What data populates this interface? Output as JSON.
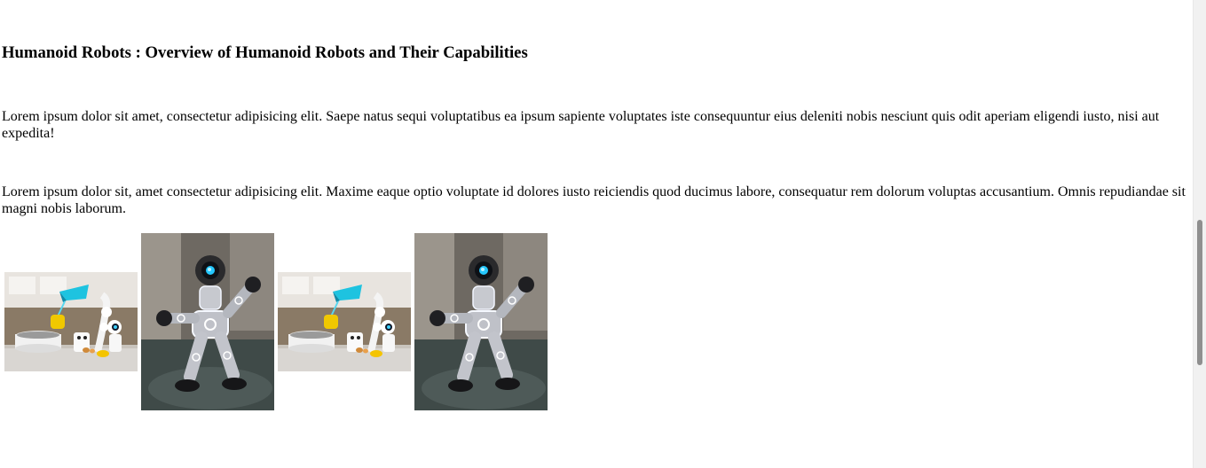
{
  "heading": "Humanoid Robots : Overview of Humanoid Robots and Their Capabilities",
  "paragraphs": [
    "Lorem ipsum dolor sit amet, consectetur adipisicing elit. Saepe natus sequi voluptatibus ea ipsum sapiente voluptates iste consequuntur eius deleniti nobis nesciunt quis odit aperiam eligendi iusto, nisi aut expedita!",
    "Lorem ipsum dolor sit, amet consectetur adipisicing elit. Maxime eaque optio voluptate id dolores iusto reiciendis quod ducimus labore, consequatur rem dolorum voluptas accusantium. Omnis repudiandae sit magni nobis laborum."
  ],
  "gallery": [
    {
      "subject": "kitchen-robot-image"
    },
    {
      "subject": "humanoid-robot-image"
    },
    {
      "subject": "kitchen-robot-image"
    },
    {
      "subject": "humanoid-robot-image"
    }
  ]
}
